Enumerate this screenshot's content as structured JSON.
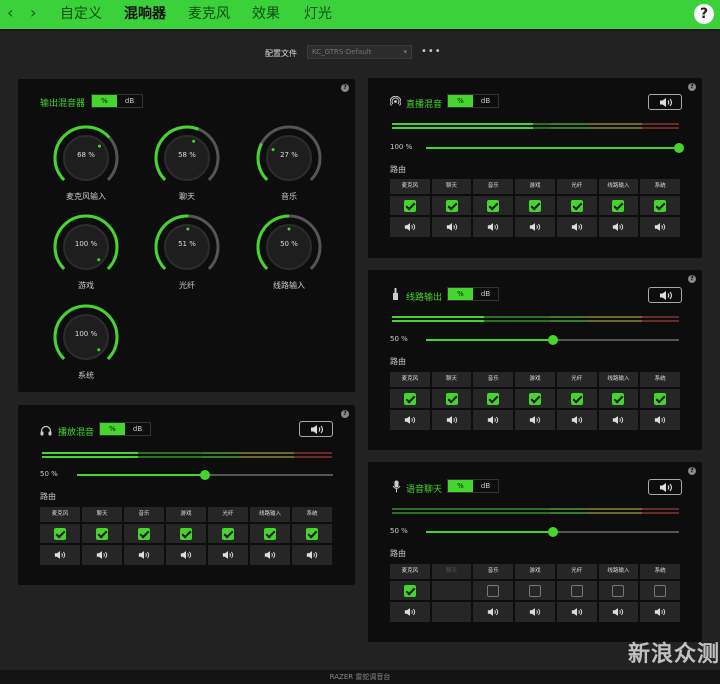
{
  "nav": {
    "back_icon": "chevron-left-icon",
    "forward_icon": "chevron-right-icon",
    "tabs": [
      {
        "label": "自定义",
        "active": false
      },
      {
        "label": "混响器",
        "active": true
      },
      {
        "label": "麦克风",
        "active": false
      },
      {
        "label": "效果",
        "active": false
      },
      {
        "label": "灯光",
        "active": false
      }
    ],
    "help": "?"
  },
  "profile": {
    "label": "配置文件",
    "value": "KC_GTRS-Default",
    "more": "•••"
  },
  "colors": {
    "accent": "#44d62c",
    "topbar": "#3ad13a",
    "panel": "#0d0d0d",
    "background": "#222222"
  },
  "output_mixer": {
    "title": "输出混音器",
    "unit_pct": "%",
    "unit_db": "dB",
    "help": "?",
    "knobs": [
      {
        "label": "麦克风输入",
        "value": "68 %",
        "level": 68
      },
      {
        "label": "聊天",
        "value": "58 %",
        "level": 58
      },
      {
        "label": "音乐",
        "value": "27 %",
        "level": 27
      },
      {
        "label": "游戏",
        "value": "100 %",
        "level": 100
      },
      {
        "label": "光纤",
        "value": "51 %",
        "level": 51
      },
      {
        "label": "线路输入",
        "value": "50 %",
        "level": 50
      },
      {
        "label": "系统",
        "value": "100 %",
        "level": 100
      }
    ]
  },
  "mixes": {
    "stream": {
      "title": "直播混音",
      "icon": "broadcast-icon",
      "unit_pct": "%",
      "unit_db": "dB",
      "help": "?",
      "volume_text": "100 %",
      "level": 100,
      "meter_level": 49,
      "route_label": "路由",
      "columns": [
        "麦克风",
        "聊天",
        "音乐",
        "游戏",
        "光纤",
        "线路输入",
        "系统"
      ],
      "checked": [
        true,
        true,
        true,
        true,
        true,
        true,
        true
      ],
      "disabled": [
        false,
        false,
        false,
        false,
        false,
        false,
        false
      ]
    },
    "line": {
      "title": "线路输出",
      "icon": "line-out-plug-icon",
      "unit_pct": "%",
      "unit_db": "dB",
      "help": "?",
      "volume_text": "50 %",
      "level": 50,
      "meter_level": 32,
      "route_label": "路由",
      "columns": [
        "麦克风",
        "聊天",
        "音乐",
        "游戏",
        "光纤",
        "线路输入",
        "系统"
      ],
      "checked": [
        true,
        true,
        true,
        true,
        true,
        true,
        true
      ],
      "disabled": [
        false,
        false,
        false,
        false,
        false,
        false,
        false
      ]
    },
    "playback": {
      "title": "播放混音",
      "icon": "headphones-icon",
      "unit_pct": "%",
      "unit_db": "dB",
      "help": "?",
      "volume_text": "50 %",
      "level": 50,
      "meter_level": 33,
      "route_label": "路由",
      "columns": [
        "麦克风",
        "聊天",
        "音乐",
        "游戏",
        "光纤",
        "线路输入",
        "系统"
      ],
      "checked": [
        true,
        true,
        true,
        true,
        true,
        true,
        true
      ],
      "disabled": [
        false,
        false,
        false,
        false,
        false,
        false,
        false
      ]
    },
    "voice": {
      "title": "语音聊天",
      "icon": "microphone-icon",
      "unit_pct": "%",
      "unit_db": "dB",
      "help": "?",
      "volume_text": "50 %",
      "level": 50,
      "meter_level": 0,
      "route_label": "路由",
      "columns": [
        "麦克风",
        "聊天",
        "音乐",
        "游戏",
        "光纤",
        "线路输入",
        "系统"
      ],
      "checked": [
        true,
        false,
        false,
        false,
        false,
        false,
        false
      ],
      "disabled": [
        false,
        true,
        false,
        false,
        false,
        false,
        false
      ]
    }
  },
  "footer": {
    "text": "RAZER 雷蛇调音台"
  },
  "watermark": {
    "text": "新浪众测"
  }
}
